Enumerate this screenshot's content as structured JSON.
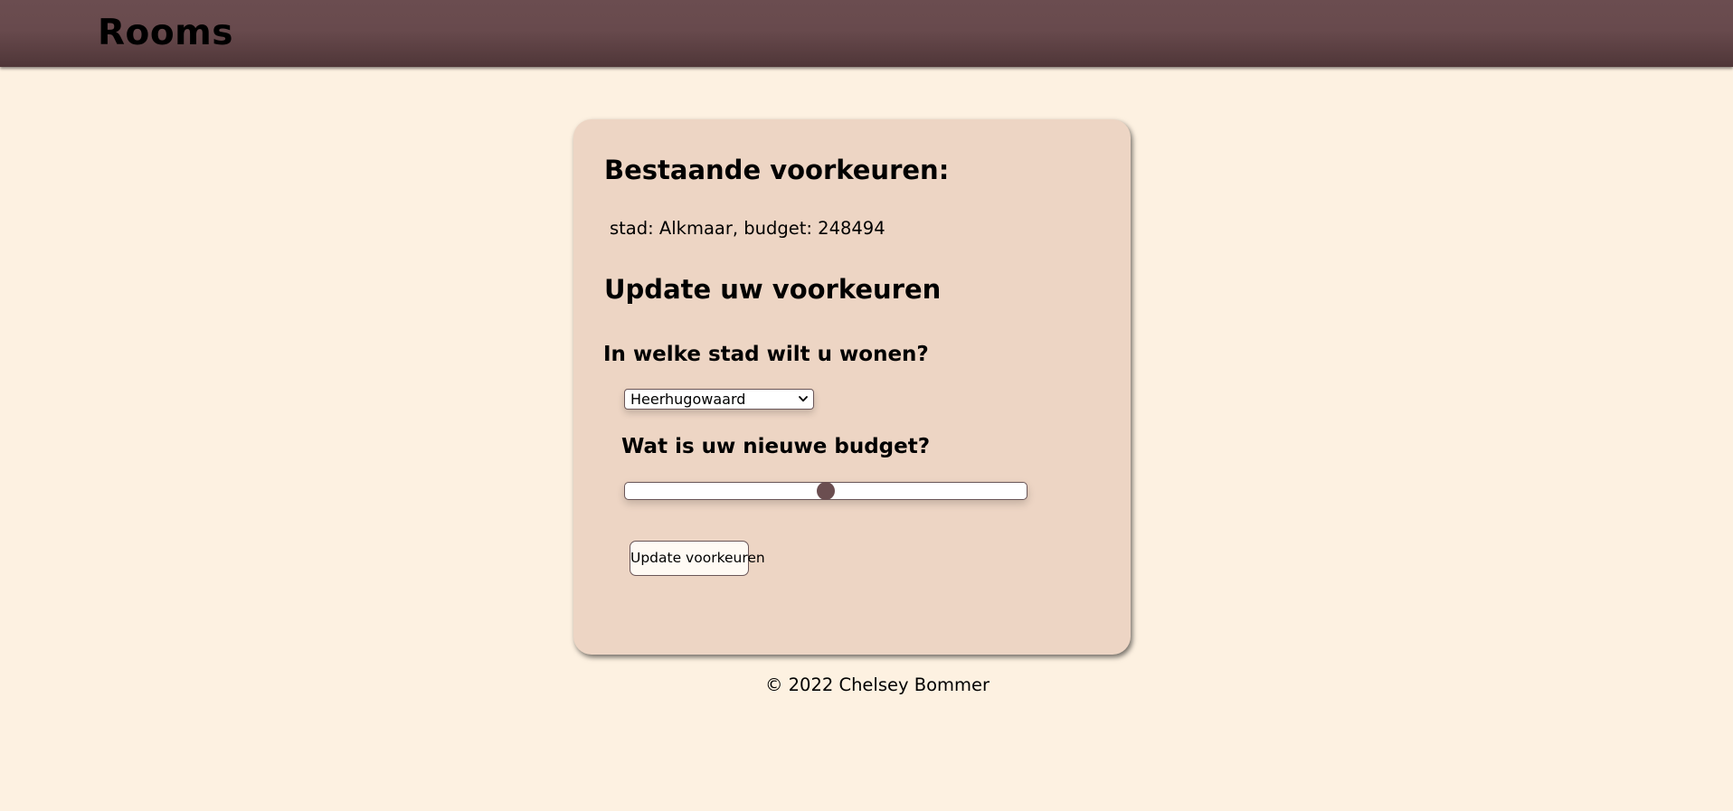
{
  "header": {
    "brand": "Rooms"
  },
  "card": {
    "existing_title": "Bestaande voorkeuren:",
    "existing_text": "stad: Alkmaar, budget: 248494",
    "update_title": "Update uw voorkeuren",
    "city_question": "In welke stad wilt u wonen?",
    "city_select": {
      "value": "Heerhugowaard",
      "icon": "chevron-down-icon"
    },
    "budget_question": "Wat is uw nieuwe budget?",
    "budget_slider": {
      "level": 0.5
    },
    "submit_label": "Update voorkeuren"
  },
  "footer": {
    "text": "© 2022 Chelsey Bommer"
  },
  "colors": {
    "page_background": "#fdf1e1",
    "header_background": "#684a4d",
    "card_background": "#edd5c4",
    "accent": "#6b4e50"
  }
}
